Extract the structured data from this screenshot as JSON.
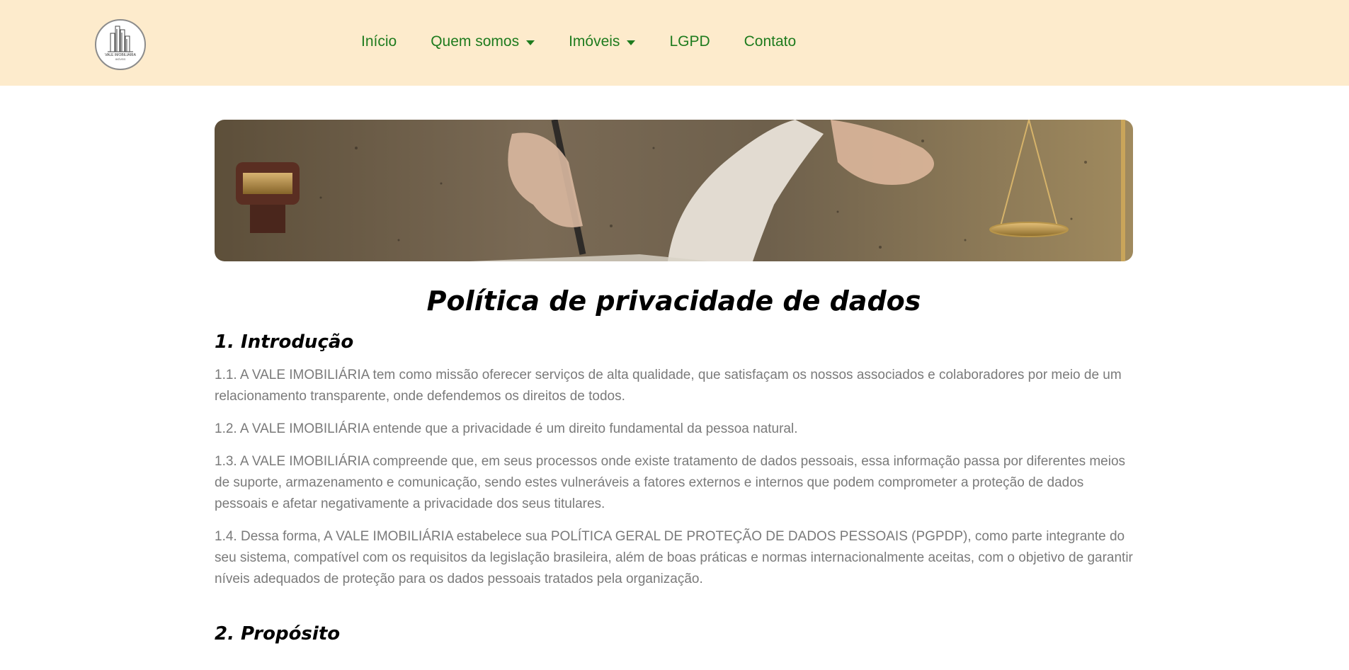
{
  "brand": {
    "logo_text": "VALE IMOBILIÁRIA",
    "logo_subtext": "IMÓVEIS"
  },
  "nav": {
    "items": [
      {
        "label": "Início",
        "dropdown": false
      },
      {
        "label": "Quem somos",
        "dropdown": true
      },
      {
        "label": "Imóveis",
        "dropdown": true
      },
      {
        "label": "LGPD",
        "dropdown": false
      },
      {
        "label": "Contato",
        "dropdown": false
      }
    ]
  },
  "page": {
    "title": "Política de privacidade de dados",
    "sections": [
      {
        "heading": "1. Introdução",
        "paragraphs": [
          "1.1. A VALE IMOBILIÁRIA tem como missão oferecer serviços de alta qualidade, que satisfaçam os nossos associados e colaboradores por meio de um relacionamento transparente, onde defendemos os direitos de todos.",
          "1.2. A VALE IMOBILIÁRIA entende que a privacidade é um direito fundamental da pessoa natural.",
          "1.3. A VALE IMOBILIÁRIA compreende que, em seus processos onde existe tratamento de dados pessoais, essa informação passa por diferentes meios de suporte, armazenamento e comunicação, sendo estes vulneráveis a fatores externos e internos que podem comprometer a proteção de dados pessoais e afetar negativamente a privacidade dos seus titulares.",
          "1.4. Dessa forma, A VALE IMOBILIÁRIA estabelece sua POLÍTICA GERAL DE PROTEÇÃO DE DADOS PESSOAIS (PGPDP), como parte integrante do seu sistema, compatível com os requisitos da legislação brasileira, além de boas práticas e normas internacionalmente aceitas, com o objetivo de garantir níveis adequados de proteção para os dados pessoais tratados pela organização."
        ]
      },
      {
        "heading": "2. Propósito",
        "paragraphs": []
      }
    ]
  },
  "colors": {
    "navbar_bg": "#fdebcc",
    "nav_link": "#1e7b1e",
    "body_text": "#7a7a7a",
    "heading": "#000000"
  },
  "banner": {
    "icons": [
      "gavel-icon",
      "pen-hand-icon",
      "document-icon",
      "scales-of-justice-icon"
    ]
  }
}
